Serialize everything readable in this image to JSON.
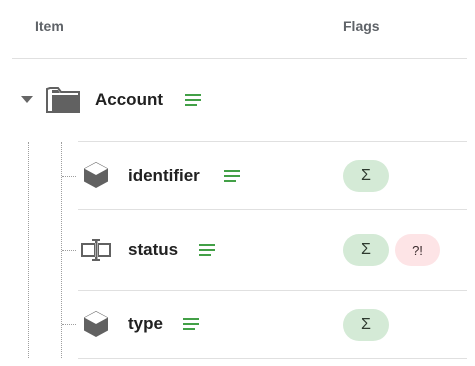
{
  "columns": {
    "item": "Item",
    "flags": "Flags"
  },
  "root": {
    "label": "Account",
    "icon": "folder-icon",
    "expanded": true
  },
  "children": [
    {
      "label": "identifier",
      "icon": "entity-cube-icon",
      "flags": [
        "Σ"
      ]
    },
    {
      "label": "status",
      "icon": "field-type-icon",
      "flags": [
        "Σ",
        "?!"
      ]
    },
    {
      "label": "type",
      "icon": "entity-cube-icon",
      "flags": [
        "Σ"
      ]
    }
  ],
  "colors": {
    "accent": "#43a047",
    "sum_chip": "#d4ead6",
    "warn_chip": "#fde4e6",
    "icon": "#616161"
  }
}
